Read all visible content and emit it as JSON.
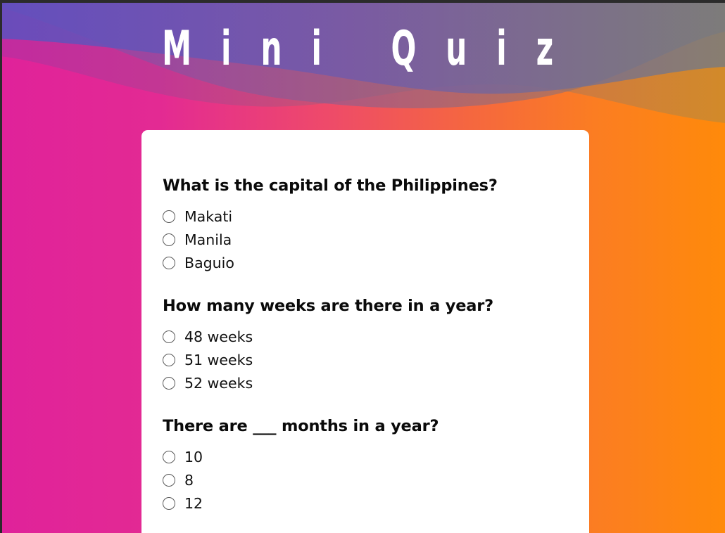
{
  "header": {
    "title": "M i n i   Q u i z"
  },
  "quiz": {
    "questions": [
      {
        "text": "What is the capital of the Philippines?",
        "options": [
          "Makati",
          "Manila",
          "Baguio"
        ]
      },
      {
        "text": "How many weeks are there in a year?",
        "options": [
          "48 weeks",
          "51 weeks",
          "52 weeks"
        ]
      },
      {
        "text": "There are ___ months in a year?",
        "options": [
          "10",
          "8",
          "12"
        ]
      }
    ]
  },
  "colors": {
    "gradient_left": "#e0229a",
    "gradient_right": "#ff8a0a",
    "header_overlay": "#6a5ab8",
    "card": "#ffffff"
  }
}
